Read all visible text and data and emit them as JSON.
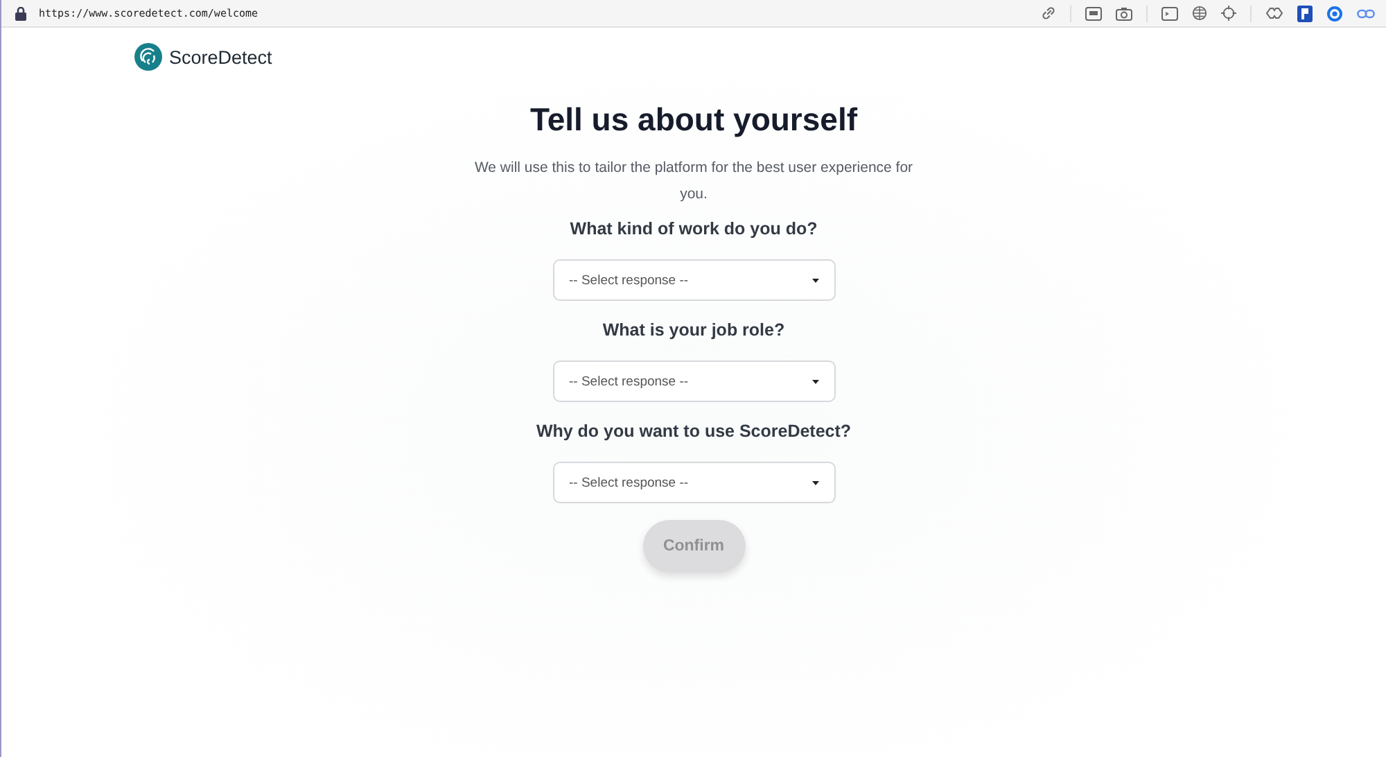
{
  "browser": {
    "url": "https://www.scoredetect.com/welcome"
  },
  "brand": {
    "name": "ScoreDetect"
  },
  "title": "Tell us about yourself",
  "subtitle": "We will use this to tailor the platform for the best user experience for you.",
  "questions": [
    {
      "label": "What kind of work do you do?",
      "placeholder": "-- Select response --"
    },
    {
      "label": "What is your job role?",
      "placeholder": "-- Select response --"
    },
    {
      "label": "Why do you want to use ScoreDetect?",
      "placeholder": "-- Select response --"
    }
  ],
  "confirm": {
    "label": "Confirm",
    "disabled": true
  }
}
